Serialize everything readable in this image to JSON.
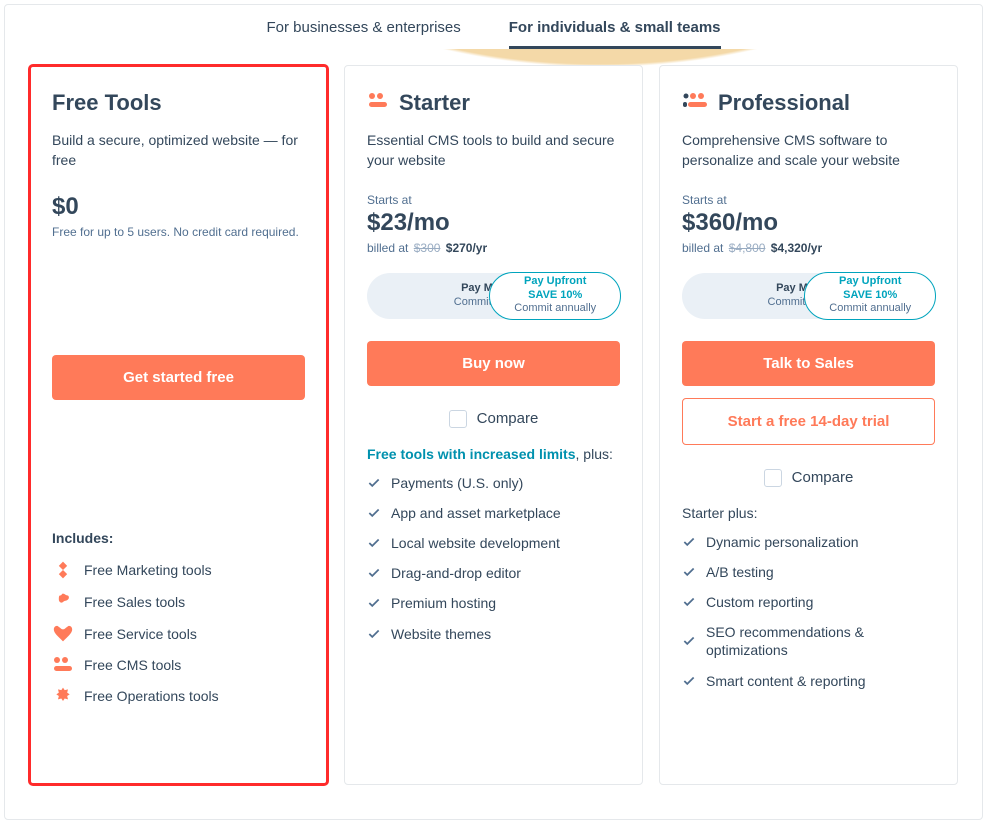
{
  "tabs": {
    "business": "For businesses & enterprises",
    "individual": "For individuals & small teams"
  },
  "plans": {
    "free": {
      "title": "Free Tools",
      "desc": "Build a secure, optimized website — for free",
      "price": "$0",
      "price_note": "Free for up to 5 users. No credit card required.",
      "cta": "Get started free",
      "includes_title": "Includes:",
      "features": [
        "Free Marketing tools",
        "Free Sales tools",
        "Free Service tools",
        "Free CMS tools",
        "Free Operations tools"
      ]
    },
    "starter": {
      "title": "Starter",
      "desc": "Essential CMS tools to build and secure your website",
      "starts_at": "Starts at",
      "price": "$23/mo",
      "billed_prefix": "billed at",
      "billed_strike": "$300",
      "billed_now": "$270/yr",
      "billing_left_l1": "Pay Monthly",
      "billing_left_l2": "Commit monthly",
      "billing_right_l1": "Pay Upfront",
      "billing_right_save": "SAVE 10%",
      "billing_right_l2": "Commit annually",
      "cta": "Buy now",
      "compare": "Compare",
      "plus_prefix": "Free tools with increased limits",
      "plus_suffix": ", plus:",
      "features": [
        "Payments (U.S. only)",
        "App and asset marketplace",
        "Local website development",
        "Drag-and-drop editor",
        "Premium hosting",
        "Website themes"
      ]
    },
    "pro": {
      "title": "Professional",
      "desc": "Comprehensive CMS software to personalize and scale your website",
      "starts_at": "Starts at",
      "price": "$360/mo",
      "billed_prefix": "billed at",
      "billed_strike": "$4,800",
      "billed_now": "$4,320/yr",
      "billing_left_l1": "Pay Monthly",
      "billing_left_l2": "Commit annually",
      "billing_right_l1": "Pay Upfront",
      "billing_right_save": "SAVE 10%",
      "billing_right_l2": "Commit annually",
      "cta1": "Talk to Sales",
      "cta2": "Start a free 14-day trial",
      "compare": "Compare",
      "plus": "Starter plus:",
      "features": [
        "Dynamic personalization",
        "A/B testing",
        "Custom reporting",
        "SEO recommendations & optimizations",
        "Smart content & reporting"
      ]
    }
  }
}
